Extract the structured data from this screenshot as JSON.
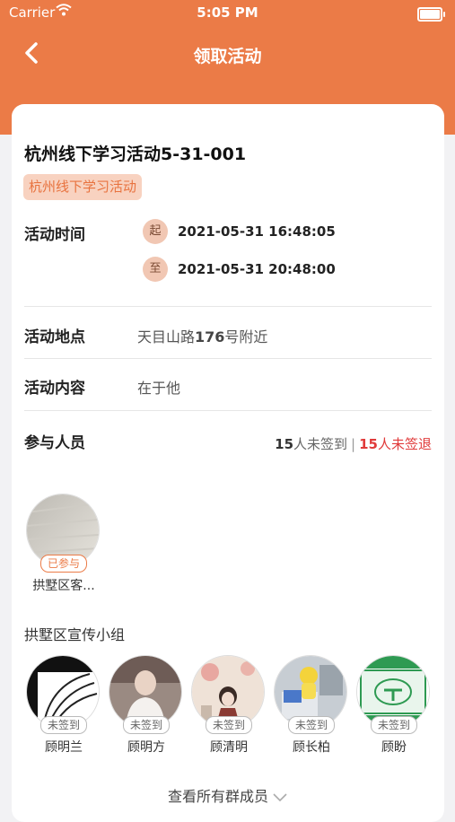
{
  "status_bar": {
    "carrier": "Carrier",
    "time": "5:05 PM"
  },
  "nav": {
    "title": "领取活动",
    "back_icon": "chevron-left-icon"
  },
  "activity": {
    "title": "杭州线下学习活动5-31-001",
    "tag": "杭州线下学习活动",
    "time_label": "活动时间",
    "start_marker": "起",
    "start_time": "2021-05-31 16:48:05",
    "end_marker": "至",
    "end_time": "2021-05-31 20:48:00",
    "location_label": "活动地点",
    "location_prefix": "天目山路",
    "location_number": "176",
    "location_suffix": "号附近",
    "content_label": "活动内容",
    "content_value": "在于他"
  },
  "participants": {
    "label": "参与人员",
    "unsigned_in_count": "15",
    "unsigned_in_text": "人未签到",
    "separator": "|",
    "unsigned_out_count": "15",
    "unsigned_out_text": "人未签退",
    "joined": [
      {
        "name": "拱墅区客...",
        "badge": "已参与"
      }
    ]
  },
  "group": {
    "title": "拱墅区宣传小组",
    "members": [
      {
        "name": "顾明兰",
        "badge": "未签到"
      },
      {
        "name": "顾明方",
        "badge": "未签到"
      },
      {
        "name": "顾清明",
        "badge": "未签到"
      },
      {
        "name": "顾长柏",
        "badge": "未签到"
      },
      {
        "name": "顾盼",
        "badge": "未签到"
      }
    ],
    "view_all": "查看所有群成员"
  },
  "colors": {
    "accent": "#eb7b47",
    "alert": "#e03a3a",
    "tag_bg": "#f8d2c0"
  }
}
